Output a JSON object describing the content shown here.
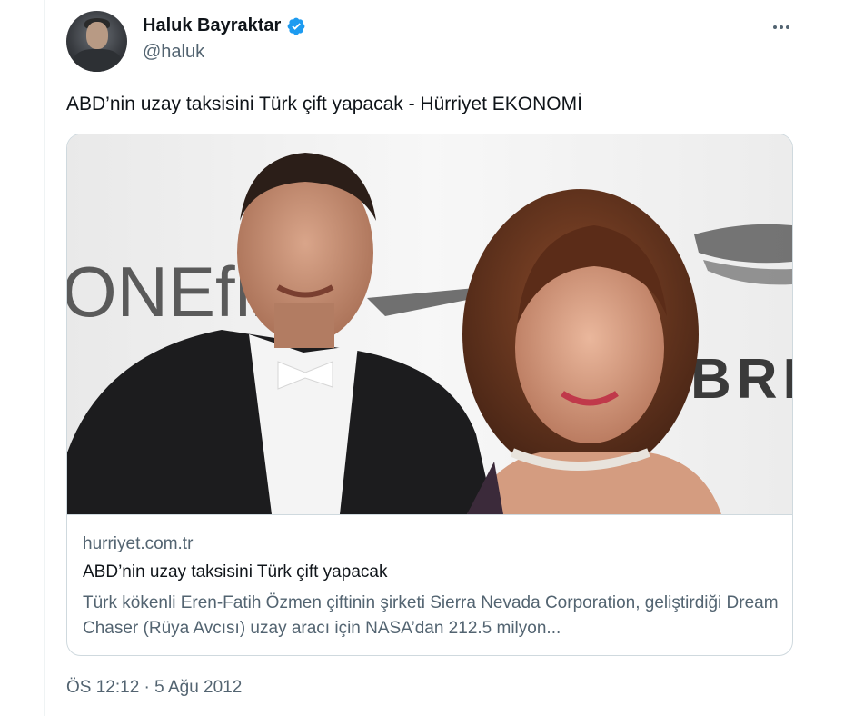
{
  "author": {
    "name": "Haluk Bayraktar",
    "handle": "@haluk",
    "verified": true,
    "avatar_icon": "profile-photo"
  },
  "tweet": {
    "text": "ABD’nin uzay taksisini Türk çift yapacak - Hürriyet EKONOMİ",
    "timestamp": "ÖS 12:12 · 5 Ağu 2012"
  },
  "card": {
    "image_icon": "article-photo",
    "image_text_left": "ONEfli",
    "image_text_right": "BRE",
    "domain": "hurriyet.com.tr",
    "title": "ABD’nin uzay taksisini Türk çift yapacak",
    "description": "Türk kökenli Eren-Fatih Özmen çiftinin şirketi Sierra Nevada Corporation, geliştirdiği Dream Chaser (Rüya Avcısı) uzay aracı için NASA’dan 212.5 milyon..."
  },
  "colors": {
    "text_primary": "#0f1419",
    "text_secondary": "#536471",
    "border": "#cfd9de",
    "verified_blue": "#1d9bf0"
  },
  "icons": {
    "more": "more-horizontal-icon",
    "verified": "verified-badge-icon"
  }
}
